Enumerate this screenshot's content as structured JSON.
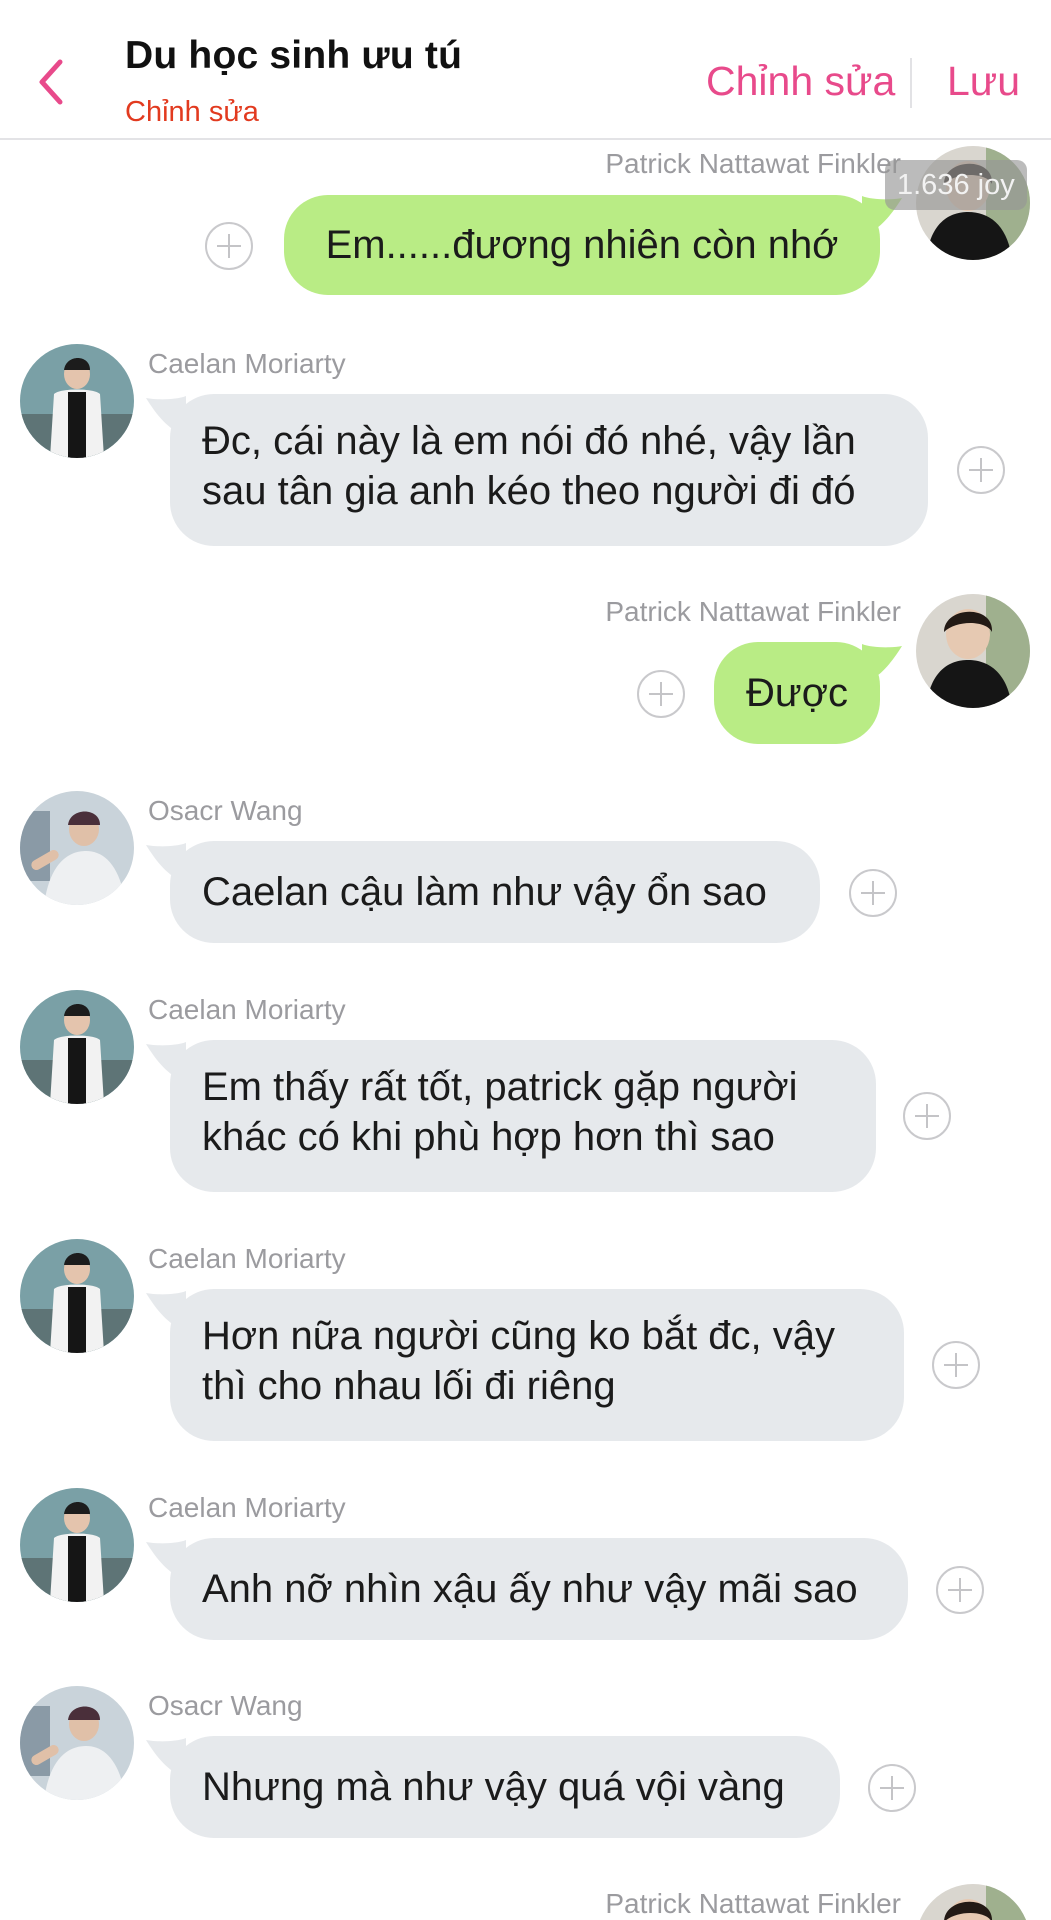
{
  "header": {
    "title": "Du học sinh ưu tú",
    "subtitle": "Chỉnh sửa",
    "edit_label": "Chỉnh sửa",
    "save_label": "Lưu",
    "accent_color": "#e84a8b",
    "subtitle_color": "#e23a1f"
  },
  "badge": {
    "text": "1.636 joy"
  },
  "colors": {
    "outgoing_bubble": "#b9ec85",
    "incoming_bubble": "#e6e9ec"
  },
  "messages": [
    {
      "sender": "Patrick Nattawat Finkler",
      "text": "Em......đương nhiên còn nhớ",
      "direction": "out"
    },
    {
      "sender": "Caelan Moriarty",
      "lines": [
        "Đc, cái này là em nói đó nhé, vậy lần",
        "sau tân gia anh kéo theo người đi đó"
      ],
      "direction": "in"
    },
    {
      "sender": "Patrick Nattawat Finkler",
      "text": "Được",
      "direction": "out"
    },
    {
      "sender": "Osacr Wang",
      "text": "Caelan cậu làm như vậy ổn sao",
      "direction": "in"
    },
    {
      "sender": "Caelan Moriarty",
      "lines": [
        "Em thấy rất tốt, patrick gặp người",
        "khác có khi phù hợp hơn thì sao"
      ],
      "direction": "in"
    },
    {
      "sender": "Caelan Moriarty",
      "lines": [
        "Hơn nữa người cũng ko bắt đc, vậy",
        "thì cho nhau lối đi riêng"
      ],
      "direction": "in"
    },
    {
      "sender": "Caelan Moriarty",
      "text": "Anh nỡ nhìn xậu ấy như vậy mãi sao",
      "direction": "in"
    },
    {
      "sender": "Osacr Wang",
      "text": "Nhưng mà như vậy quá vội vàng",
      "direction": "in"
    },
    {
      "sender": "Patrick Nattawat Finkler",
      "direction": "out"
    }
  ]
}
